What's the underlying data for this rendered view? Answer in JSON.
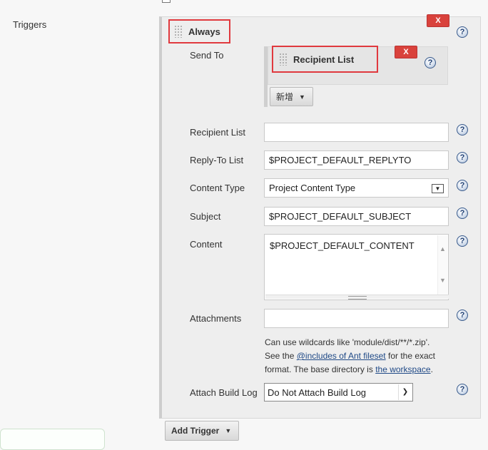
{
  "triggers_label": "Triggers",
  "always": {
    "heading": "Always",
    "delete_label": "X"
  },
  "send_to": {
    "label": "Send To",
    "recipient_list_heading": "Recipient List",
    "delete_label": "X",
    "add_button_label": "新增"
  },
  "fields": {
    "recipient_list": {
      "label": "Recipient List",
      "value": ""
    },
    "reply_to": {
      "label": "Reply-To List",
      "value": "$PROJECT_DEFAULT_REPLYTO"
    },
    "content_type": {
      "label": "Content Type",
      "value": "Project Content Type"
    },
    "subject": {
      "label": "Subject",
      "value": "$PROJECT_DEFAULT_SUBJECT"
    },
    "content": {
      "label": "Content",
      "value": "$PROJECT_DEFAULT_CONTENT"
    },
    "attachments": {
      "label": "Attachments",
      "value": ""
    },
    "attach_build_log": {
      "label": "Attach Build Log",
      "value": "Do Not Attach Build Log"
    }
  },
  "attachments_note": {
    "line1": "Can use wildcards like 'module/dist/**/*.zip'.",
    "see_the": "See the",
    "link1": "@includes of Ant fileset",
    "for_exact": "for the exact",
    "format_prefix": "format. The base directory is",
    "link2": "the workspace",
    "period": "."
  },
  "add_trigger_label": "Add Trigger",
  "help_icon_text": "?",
  "colors": {
    "delete": "#d9423c",
    "highlight_border": "#e0393e",
    "link": "#204a87"
  }
}
